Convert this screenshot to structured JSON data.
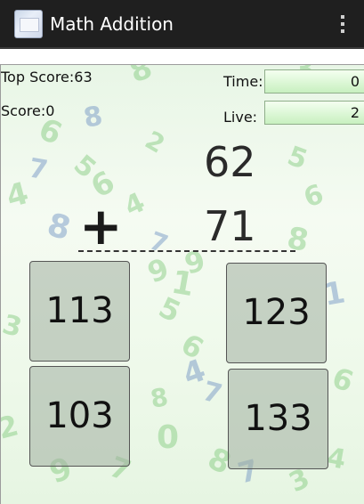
{
  "app": {
    "title": "Math Addition",
    "icon": "app-icon",
    "menu_icon": "overflow-menu-icon"
  },
  "stats": {
    "top_score_label": "Top Score:63",
    "score_label": "Score:0",
    "time_label": "Time:",
    "time_value": "0",
    "live_label": "Live:",
    "live_value": "2"
  },
  "problem": {
    "operand_1": "62",
    "operator": "+",
    "operand_2": "71"
  },
  "answers": [
    "113",
    "123",
    "103",
    "133"
  ],
  "colors": {
    "actionbar": "#1f1f1f",
    "background_green": "#e8f6e6",
    "field_green": "#c8f0c0",
    "digit_green": "#7fc97a",
    "digit_blue": "#6b8fc2"
  }
}
